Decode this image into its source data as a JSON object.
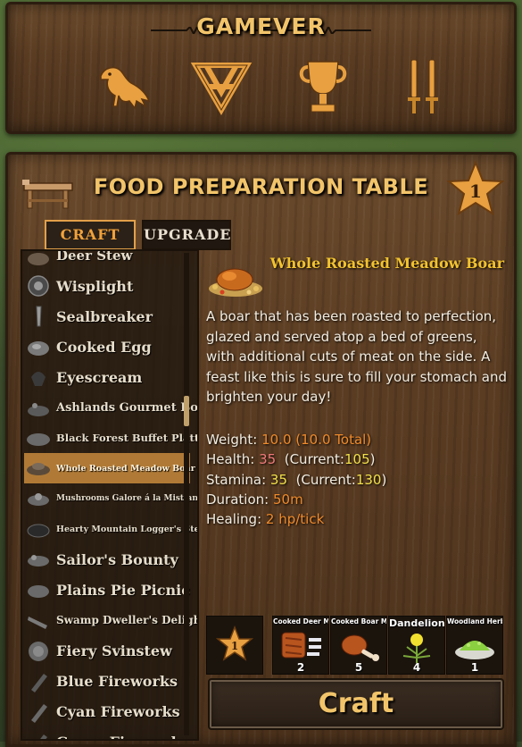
{
  "header": {
    "title": "GAMEVER",
    "icons": [
      "raven-icon",
      "valknut-icon",
      "trophy-icon",
      "swords-icon"
    ]
  },
  "station": {
    "title": "FOOD PREPARATION TABLE",
    "level": "1",
    "tabs": {
      "craft": "CRAFT",
      "upgrade": "UPGRADE"
    }
  },
  "recipes": [
    {
      "label": "Deer Stew",
      "size": "15px"
    },
    {
      "label": "Wisplight",
      "size": "16px"
    },
    {
      "label": "Sealbreaker",
      "size": "16px"
    },
    {
      "label": "Cooked Egg",
      "size": "16px"
    },
    {
      "label": "Eyescream",
      "size": "16px"
    },
    {
      "label": "Ashlands Gourmet Bowl",
      "size": "13px"
    },
    {
      "label": "Black Forest Buffet Platter",
      "size": "11.5px"
    },
    {
      "label": "Whole Roasted Meadow Boar",
      "size": "9.5px",
      "selected": true
    },
    {
      "label": "Mushrooms Galore á la Mistlands",
      "size": "9px"
    },
    {
      "label": "Hearty Mountain Logger's Stew",
      "size": "9.5px"
    },
    {
      "label": "Sailor's Bounty",
      "size": "16px"
    },
    {
      "label": "Plains Pie Picnic",
      "size": "16px"
    },
    {
      "label": "Swamp Dweller's Delight",
      "size": "12px"
    },
    {
      "label": "Fiery Svinstew",
      "size": "16px"
    },
    {
      "label": "Blue Fireworks",
      "size": "16px"
    },
    {
      "label": "Cyan Fireworks",
      "size": "16px"
    },
    {
      "label": "Green Fireworks",
      "size": "16px"
    }
  ],
  "selected": {
    "name": "Whole Roasted Meadow Boar",
    "description": "A boar that has been roasted to perfection, glazed and served atop a bed of greens, with additional cuts of meat on the side. A feast like this is sure to fill your stomach and brighten your day!",
    "stats": {
      "weight_label": "Weight:",
      "weight_value": "10.0 (10.0 Total)",
      "health_label": "Health:",
      "health_value": "35",
      "health_current_label": "(Current:",
      "health_current": "105",
      "health_close": ")",
      "stamina_label": "Stamina:",
      "stamina_value": "35",
      "stamina_current_label": "(Current:",
      "stamina_current": "130",
      "stamina_close": ")",
      "duration_label": "Duration:",
      "duration_value": "50m",
      "healing_label": "Healing:",
      "healing_value": "2 hp/tick"
    }
  },
  "requirements": {
    "station_level": "1",
    "items": [
      {
        "name": "Cooked Deer Meat",
        "amount": "2"
      },
      {
        "name": "Cooked Boar Meat",
        "amount": "5"
      },
      {
        "name": "Dandelion",
        "amount": "4"
      },
      {
        "name": "Woodland Herb Blend",
        "amount": "1"
      }
    ]
  },
  "craft_button": "Craft",
  "colors": {
    "accent": "#f2c46a",
    "selected_row": "#b07a36",
    "name_yellow": "#f2c22e",
    "value_orange": "#f08a2a"
  }
}
